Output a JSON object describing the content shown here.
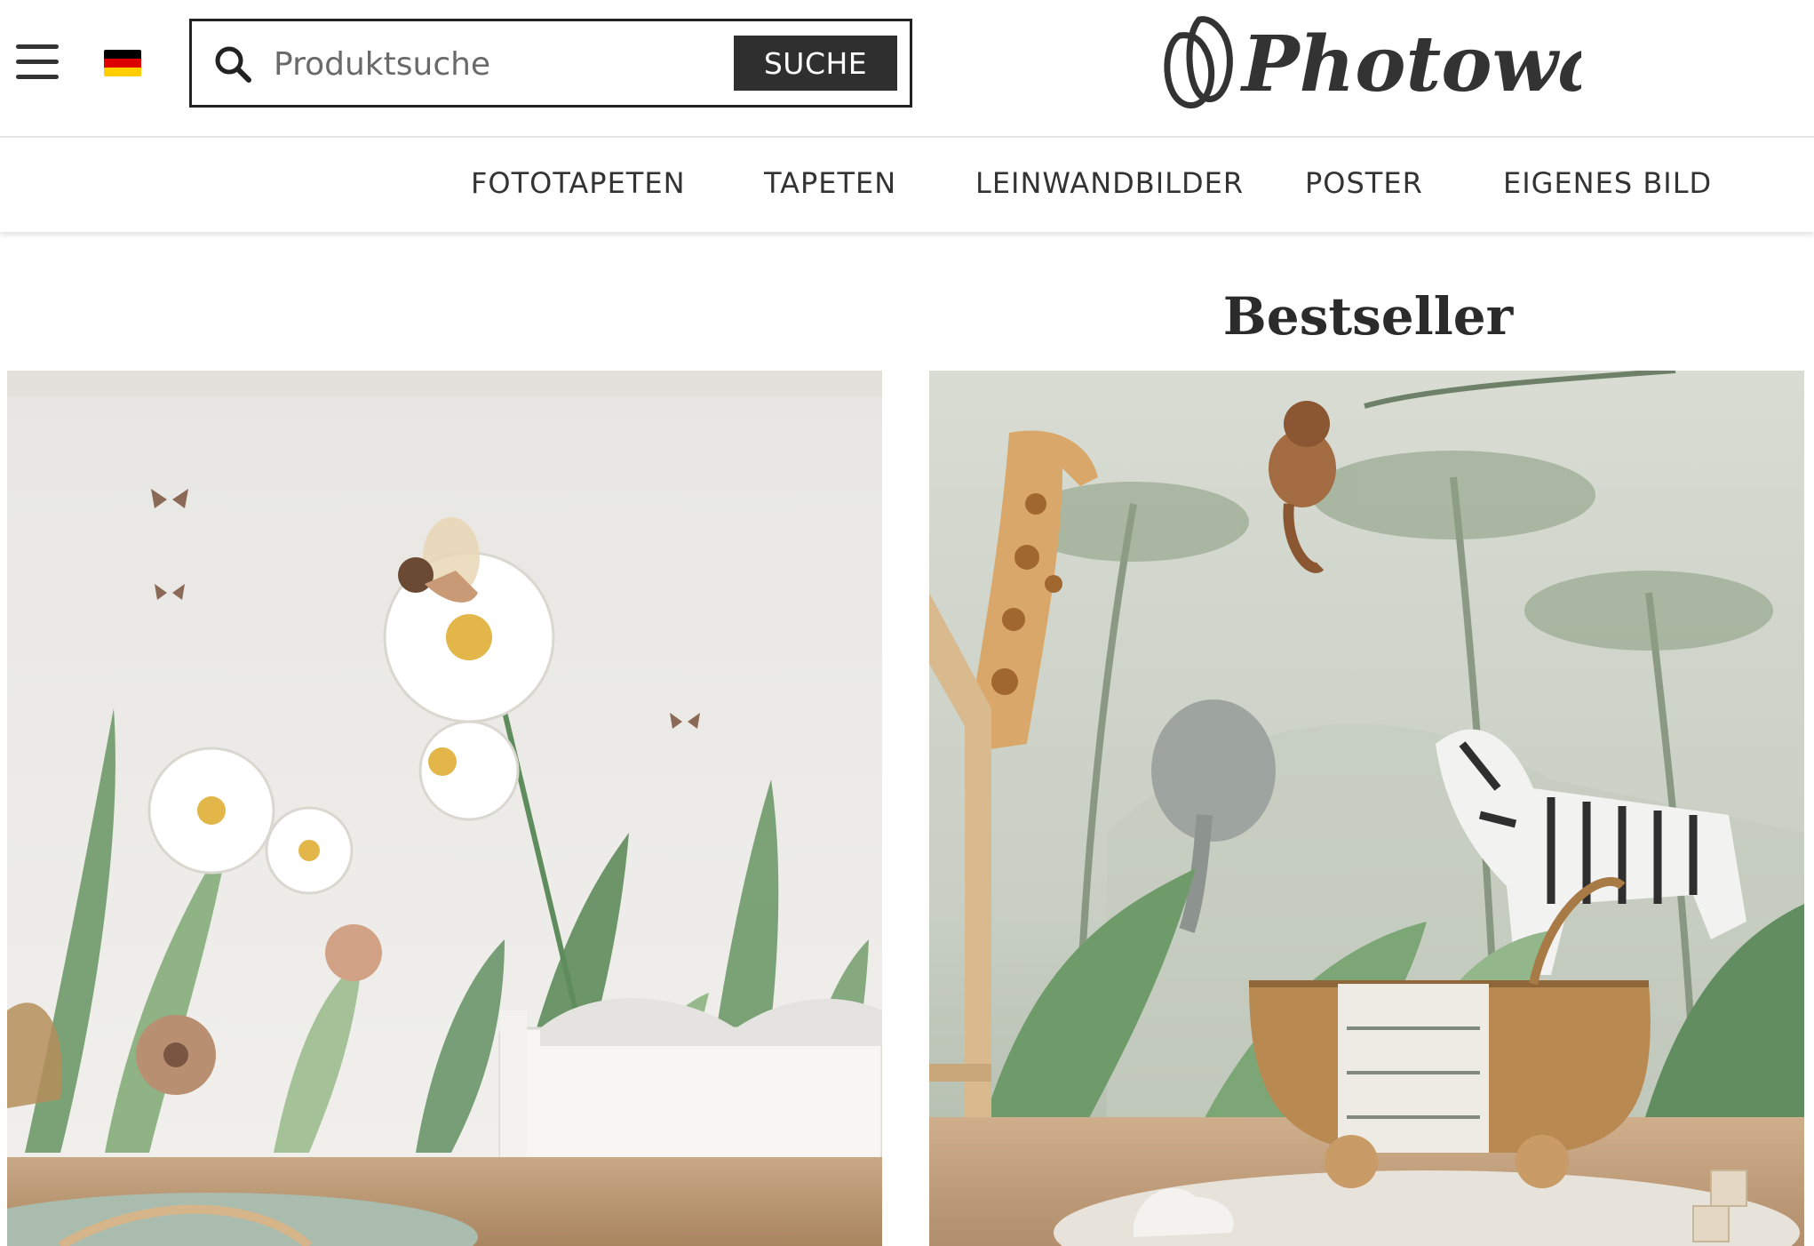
{
  "header": {
    "menu_icon": "hamburger-menu-icon",
    "flag_icon": "germany-flag-icon",
    "search": {
      "placeholder": "Produktsuche",
      "button_label": "SUCHE",
      "icon": "search-icon"
    },
    "logo_text": "Photowall"
  },
  "nav": {
    "items": [
      {
        "label": "FOTOTAPETEN"
      },
      {
        "label": "TAPETEN"
      },
      {
        "label": "LEINWANDBILDER"
      },
      {
        "label": "POSTER"
      },
      {
        "label": "EIGENES BILD"
      }
    ]
  },
  "main": {
    "section_title": "Bestseller",
    "products": [
      {
        "image": "floral-fairy-meadow-wallpaper-kids-room"
      },
      {
        "image": "jungle-animals-wallpaper-nursery"
      }
    ]
  },
  "colors": {
    "text": "#2b2b2b",
    "button_bg": "#2f2f2f",
    "button_text": "#ffffff",
    "border": "#222222",
    "divider": "#e6e6e6"
  }
}
